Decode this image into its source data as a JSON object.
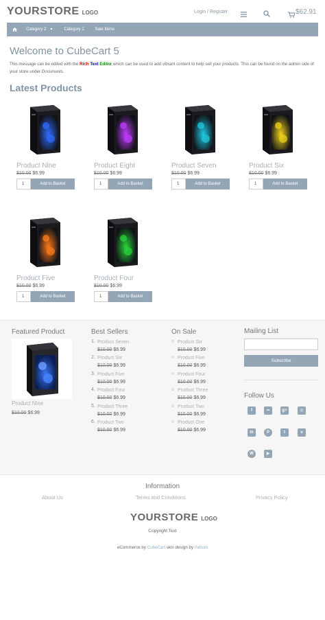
{
  "header": {
    "logo_main": "YOURSTORE",
    "logo_sub": "LOGO",
    "login_link": "Login / Register",
    "basket_total": "$62.91",
    "icons": [
      "menu-icon",
      "search-icon",
      "cart-icon"
    ]
  },
  "nav": {
    "home_icon": "home-icon",
    "items": [
      {
        "label": "Category 2",
        "has_dropdown": true
      },
      {
        "label": "Category 1"
      },
      {
        "label": "Sale Items"
      }
    ]
  },
  "welcome": {
    "title": "Welcome to CubeCart 5",
    "msg_part1": "This message can be edited with the ",
    "msg_rich": "Rich",
    "msg_text": "Text",
    "msg_editor": "Editor",
    "msg_part2": " which can be used to add vibrant content to help sell your products. This can be found on the admin side of your store under ",
    "msg_documents": "Documents",
    "msg_end": "."
  },
  "latest": {
    "title": "Latest Products",
    "add_label": "Add to Basket",
    "products": [
      {
        "name": "Product Nine",
        "old_price": "$10.00",
        "price": "$6.99",
        "qty": "1",
        "glow": "#2f6bff"
      },
      {
        "name": "Product Eight",
        "old_price": "$10.00",
        "price": "$6.99",
        "qty": "1",
        "glow": "#c23bff"
      },
      {
        "name": "Product Seven",
        "old_price": "$10.00",
        "price": "$6.99",
        "qty": "1",
        "glow": "#1fc7e0"
      },
      {
        "name": "Product Six",
        "old_price": "$10.00",
        "price": "$6.99",
        "qty": "1",
        "glow": "#f0d21a"
      },
      {
        "name": "Product Five",
        "old_price": "$10.00",
        "price": "$6.99",
        "qty": "1",
        "glow": "#ff7a1a"
      },
      {
        "name": "Product Four",
        "old_price": "$10.00",
        "price": "$6.99",
        "qty": "1",
        "glow": "#27d63a"
      }
    ]
  },
  "featured": {
    "title": "Featured Product",
    "name": "Product Nine",
    "old_price": "$10.00",
    "price": "$6.99"
  },
  "best_sellers": {
    "title": "Best Sellers",
    "items": [
      {
        "n": "1.",
        "name": "Product Seven",
        "old_price": "$10.00",
        "price": "$6.99"
      },
      {
        "n": "2.",
        "name": "Product Six",
        "old_price": "$10.00",
        "price": "$6.99"
      },
      {
        "n": "3.",
        "name": "Product Five",
        "old_price": "$10.00",
        "price": "$6.99"
      },
      {
        "n": "4.",
        "name": "Product Four",
        "old_price": "$10.00",
        "price": "$6.99"
      },
      {
        "n": "5.",
        "name": "Product Three",
        "old_price": "$10.00",
        "price": "$6.99"
      },
      {
        "n": "6.",
        "name": "Product Two",
        "old_price": "$10.00",
        "price": "$6.99"
      }
    ]
  },
  "on_sale": {
    "title": "On Sale",
    "items": [
      {
        "name": "Product Six",
        "old_price": "$10.00",
        "price": "$6.99"
      },
      {
        "name": "Product Five",
        "old_price": "$10.00",
        "price": "$6.99"
      },
      {
        "name": "Product Four",
        "old_price": "$10.00",
        "price": "$6.99"
      },
      {
        "name": "Product Three",
        "old_price": "$10.00",
        "price": "$6.99"
      },
      {
        "name": "Product Two",
        "old_price": "$10.00",
        "price": "$6.99"
      },
      {
        "name": "Product One",
        "old_price": "$10.00",
        "price": "$6.99"
      }
    ]
  },
  "mailing": {
    "title": "Mailing List",
    "subscribe_label": "Subscribe"
  },
  "follow": {
    "title": "Follow Us",
    "icons": [
      "facebook-icon",
      "flickr-icon",
      "google-plus-icon",
      "instagram-icon",
      "linkedin-icon",
      "pinterest-icon",
      "twitter-icon",
      "vimeo-icon",
      "wordpress-icon",
      "youtube-icon"
    ]
  },
  "footer": {
    "info_title": "Information",
    "links": [
      "About Us",
      "Terms and Conditions",
      "Privacy Policy"
    ],
    "logo_main": "YOURSTORE",
    "logo_sub": "LOGO",
    "copyright": "Copyright Text",
    "credit_prefix": "eCommerce by ",
    "credit_cubecart": "CubeCart",
    "credit_middle": " skin design by ",
    "credit_indrum": "Indrum"
  },
  "colors": {
    "accent": "#94a6b6",
    "heading": "#8093a3",
    "product_name": "#a7b0b8"
  }
}
